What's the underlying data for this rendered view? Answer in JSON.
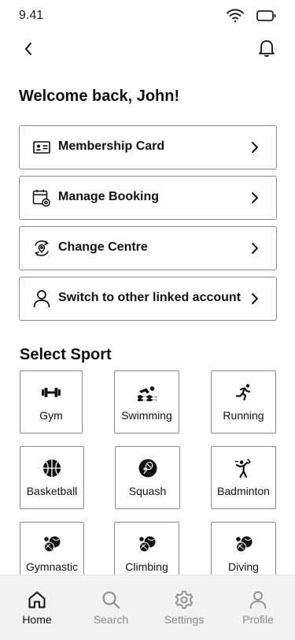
{
  "status_bar": {
    "time": "9.41"
  },
  "header": {
    "welcome": "Welcome back, John!"
  },
  "menu": {
    "items": [
      {
        "label": "Membership Card",
        "icon": "id-card-icon"
      },
      {
        "label": "Manage Booking",
        "icon": "calendar-settings-icon"
      },
      {
        "label": "Change Centre",
        "icon": "location-refresh-icon"
      },
      {
        "label": "Switch to other linked account",
        "icon": "user-icon"
      }
    ]
  },
  "sports": {
    "title": "Select Sport",
    "items": [
      {
        "label": "Gym",
        "icon": "dumbbell-icon"
      },
      {
        "label": "Swimming",
        "icon": "swimmer-icon"
      },
      {
        "label": "Running",
        "icon": "runner-icon"
      },
      {
        "label": "Basketball",
        "icon": "basketball-icon"
      },
      {
        "label": "Squash",
        "icon": "squash-icon"
      },
      {
        "label": "Badminton",
        "icon": "badminton-icon"
      },
      {
        "label": "Gymnastic",
        "icon": "sports-balls-icon"
      },
      {
        "label": "Climbing",
        "icon": "sports-balls-icon"
      },
      {
        "label": "Diving",
        "icon": "sports-balls-icon"
      }
    ]
  },
  "bottom_nav": {
    "tabs": [
      {
        "label": "Home",
        "icon": "home-icon",
        "active": true
      },
      {
        "label": "Search",
        "icon": "search-icon",
        "active": false
      },
      {
        "label": "Settings",
        "icon": "gear-icon",
        "active": false
      },
      {
        "label": "Profile",
        "icon": "profile-icon",
        "active": false
      }
    ]
  },
  "colors": {
    "text": "#111111",
    "border": "#8a8a8a",
    "nav_bg": "#f2f2f2",
    "inactive": "#8a8a8a"
  }
}
